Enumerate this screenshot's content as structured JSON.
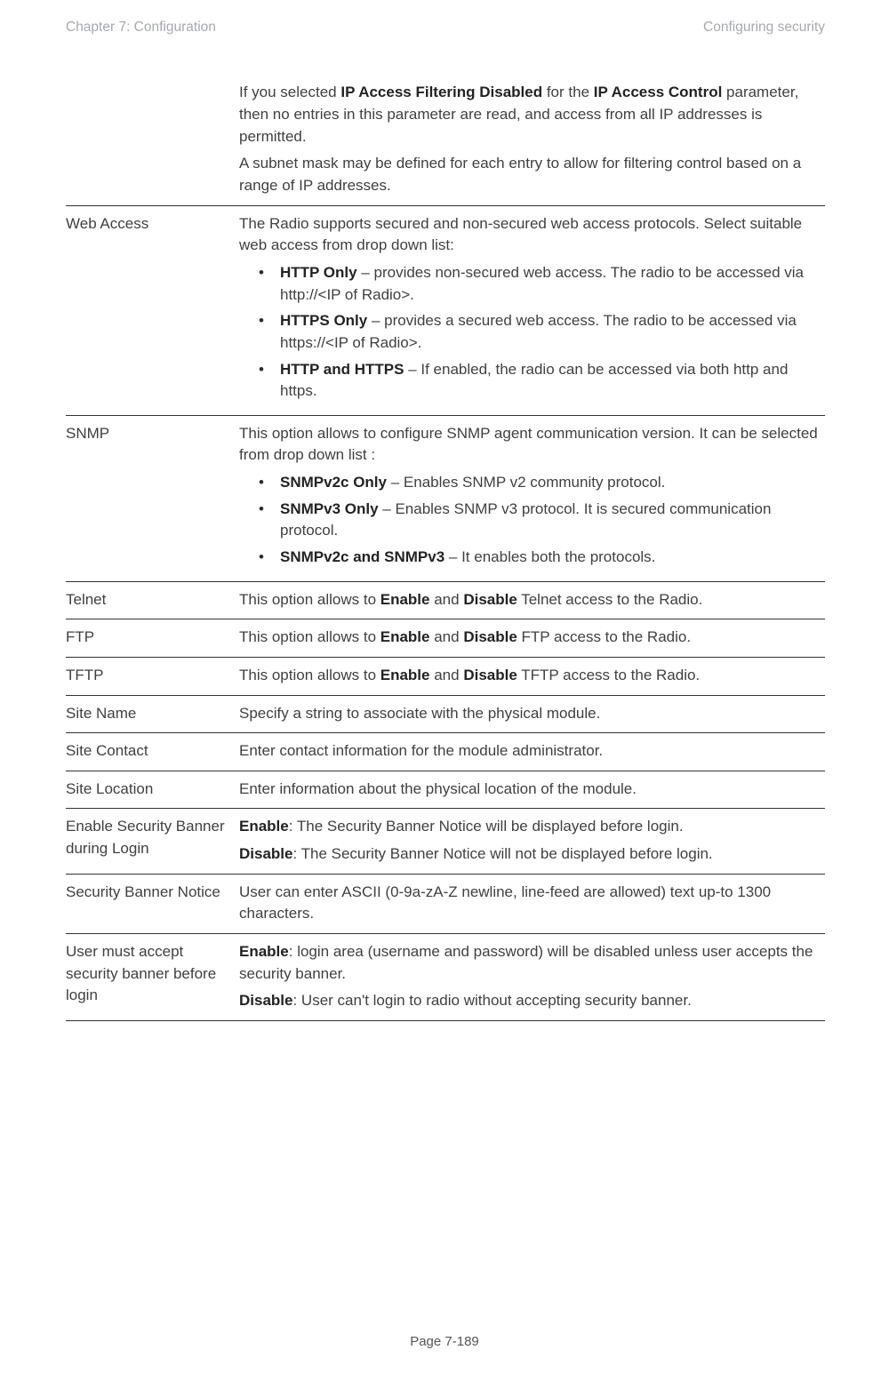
{
  "header": {
    "left": "Chapter 7:  Configuration",
    "right": "Configuring security"
  },
  "rows": {
    "r0_p1a": "If you selected ",
    "r0_p1b": "IP Access Filtering Disabled",
    "r0_p1c": " for the ",
    "r0_p1d": "IP Access Control",
    "r0_p1e": " parameter, then no entries in this parameter are read, and access from all IP addresses is permitted.",
    "r0_p2": "A subnet mask may be defined for each entry to allow for filtering control based on a range of IP addresses.",
    "r1_attr": "Web Access",
    "r1_p1": "The Radio supports secured and non-secured web access protocols. Select suitable web access from drop down list:",
    "r1_b1a": "HTTP Only",
    "r1_b1b": " – provides non-secured web access. The radio to be accessed via http://<IP of Radio>.",
    "r1_b2a": "HTTPS Only",
    "r1_b2b": " – provides a secured web access. The radio to be accessed via https://<IP of Radio>.",
    "r1_b3a": "HTTP and HTTPS",
    "r1_b3b": " – If enabled, the radio can be accessed via both http and https.",
    "r2_attr": "SNMP",
    "r2_p1": "This option allows to configure SNMP agent communication version. It can be selected from drop down list :",
    "r2_b1a": "SNMPv2c Only",
    "r2_b1b": " – Enables SNMP v2 community protocol.",
    "r2_b2a": "SNMPv3 Only",
    "r2_b2b": " – Enables SNMP v3 protocol. It is secured communication protocol.",
    "r2_b3a": "SNMPv2c and SNMPv3",
    "r2_b3b": " – It enables both the protocols.",
    "r3_attr": "Telnet",
    "r3_a": "This option allows to ",
    "r3_b": "Enable",
    "r3_c": " and ",
    "r3_d": "Disable",
    "r3_e": " Telnet access to the Radio.",
    "r4_attr": "FTP",
    "r4_a": "This option allows to ",
    "r4_b": "Enable",
    "r4_c": " and ",
    "r4_d": "Disable",
    "r4_e": " FTP access to the Radio.",
    "r5_attr": "TFTP",
    "r5_a": "This option allows to ",
    "r5_b": "Enable",
    "r5_c": " and ",
    "r5_d": "Disable",
    "r5_e": " TFTP access to the Radio.",
    "r6_attr": "Site Name",
    "r6_desc": "Specify a string to associate with the physical module.",
    "r7_attr": "Site Contact",
    "r7_desc": "Enter contact information for the module administrator.",
    "r8_attr": "Site Location",
    "r8_desc": "Enter information about the physical location of the module.",
    "r9_attr": "Enable Security Banner during Login",
    "r9_p1a": "Enable",
    "r9_p1b": ": The Security Banner Notice will be displayed before login.",
    "r9_p2a": "Disable",
    "r9_p2b": ": The Security Banner Notice will not be displayed before login.",
    "r10_attr": "Security Banner Notice",
    "r10_desc": "User can enter ASCII (0-9a-zA-Z newline, line-feed are allowed) text up-to 1300 characters.",
    "r11_attr": "User must accept security banner before login",
    "r11_p1a": "Enable",
    "r11_p1b": ": login area (username and password) will be disabled unless user accepts the security banner.",
    "r11_p2a": "Disable",
    "r11_p2b": ": User can't login to radio without accepting security banner."
  },
  "footer": "Page 7-189"
}
